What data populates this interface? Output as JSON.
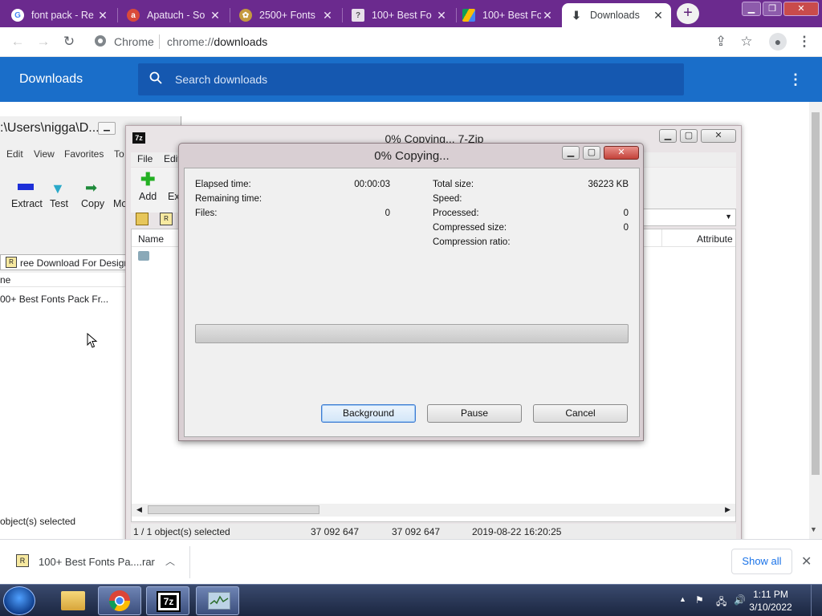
{
  "browser": {
    "tabs": [
      {
        "title": "font pack - Re",
        "icon": "google-icon"
      },
      {
        "title": "Apatuch - So",
        "icon": "site-icon"
      },
      {
        "title": "2500+ Fonts",
        "icon": "site-icon"
      },
      {
        "title": "100+ Best Fo",
        "icon": "site-icon"
      },
      {
        "title": "100+ Best Fo",
        "icon": "google-drive-icon"
      },
      {
        "title": "Downloads",
        "icon": "download-icon"
      }
    ],
    "active_tab": 5,
    "omnibox_site": "Chrome",
    "omnibox_scheme": "chrome://",
    "omnibox_path": "downloads"
  },
  "downloads": {
    "title": "Downloads",
    "search_placeholder": "Search downloads"
  },
  "shelf": {
    "file_name": "100+ Best Fonts Pa....rar",
    "show_all": "Show all"
  },
  "explorer": {
    "title": ":\\Users\\nigga\\D...",
    "menu": [
      "Edit",
      "View",
      "Favorites",
      "To"
    ],
    "tools": [
      "Extract",
      "Test",
      "Copy",
      "Mo"
    ],
    "address": "ree Download For Design",
    "column": "ne",
    "item": "00+ Best Fonts Pack Fr...",
    "status": "object(s) selected"
  },
  "sevenzip": {
    "title": "0% Copying... 7-Zip",
    "menu": [
      "File",
      "Edit"
    ],
    "tools": [
      "Add",
      "Ex"
    ],
    "columns": [
      "Name",
      "Attribute"
    ],
    "status": {
      "selected": "1 / 1 object(s) selected",
      "size": "37 092 647",
      "packed": "37 092 647",
      "modified": "2019-08-22 16:20:25"
    }
  },
  "dialog": {
    "title": "0% Copying...",
    "left_labels": [
      "Elapsed time:",
      "Remaining time:",
      "Files:"
    ],
    "left_values": [
      "00:00:03",
      "",
      "0"
    ],
    "right_labels": [
      "Total size:",
      "Speed:",
      "Processed:",
      "Compressed size:",
      "Compression ratio:"
    ],
    "right_values": [
      "36223 KB",
      "",
      "0",
      "0",
      ""
    ],
    "progress_fraction": 0,
    "buttons": {
      "background": "Background",
      "pause": "Pause",
      "cancel": "Cancel"
    }
  },
  "taskbar": {
    "time": "1:11 PM",
    "date": "3/10/2022"
  },
  "colors": {
    "chrome_frame": "#6b2a8e",
    "downloads_header": "#1a6ec9",
    "link_blue": "#1a73e8"
  }
}
